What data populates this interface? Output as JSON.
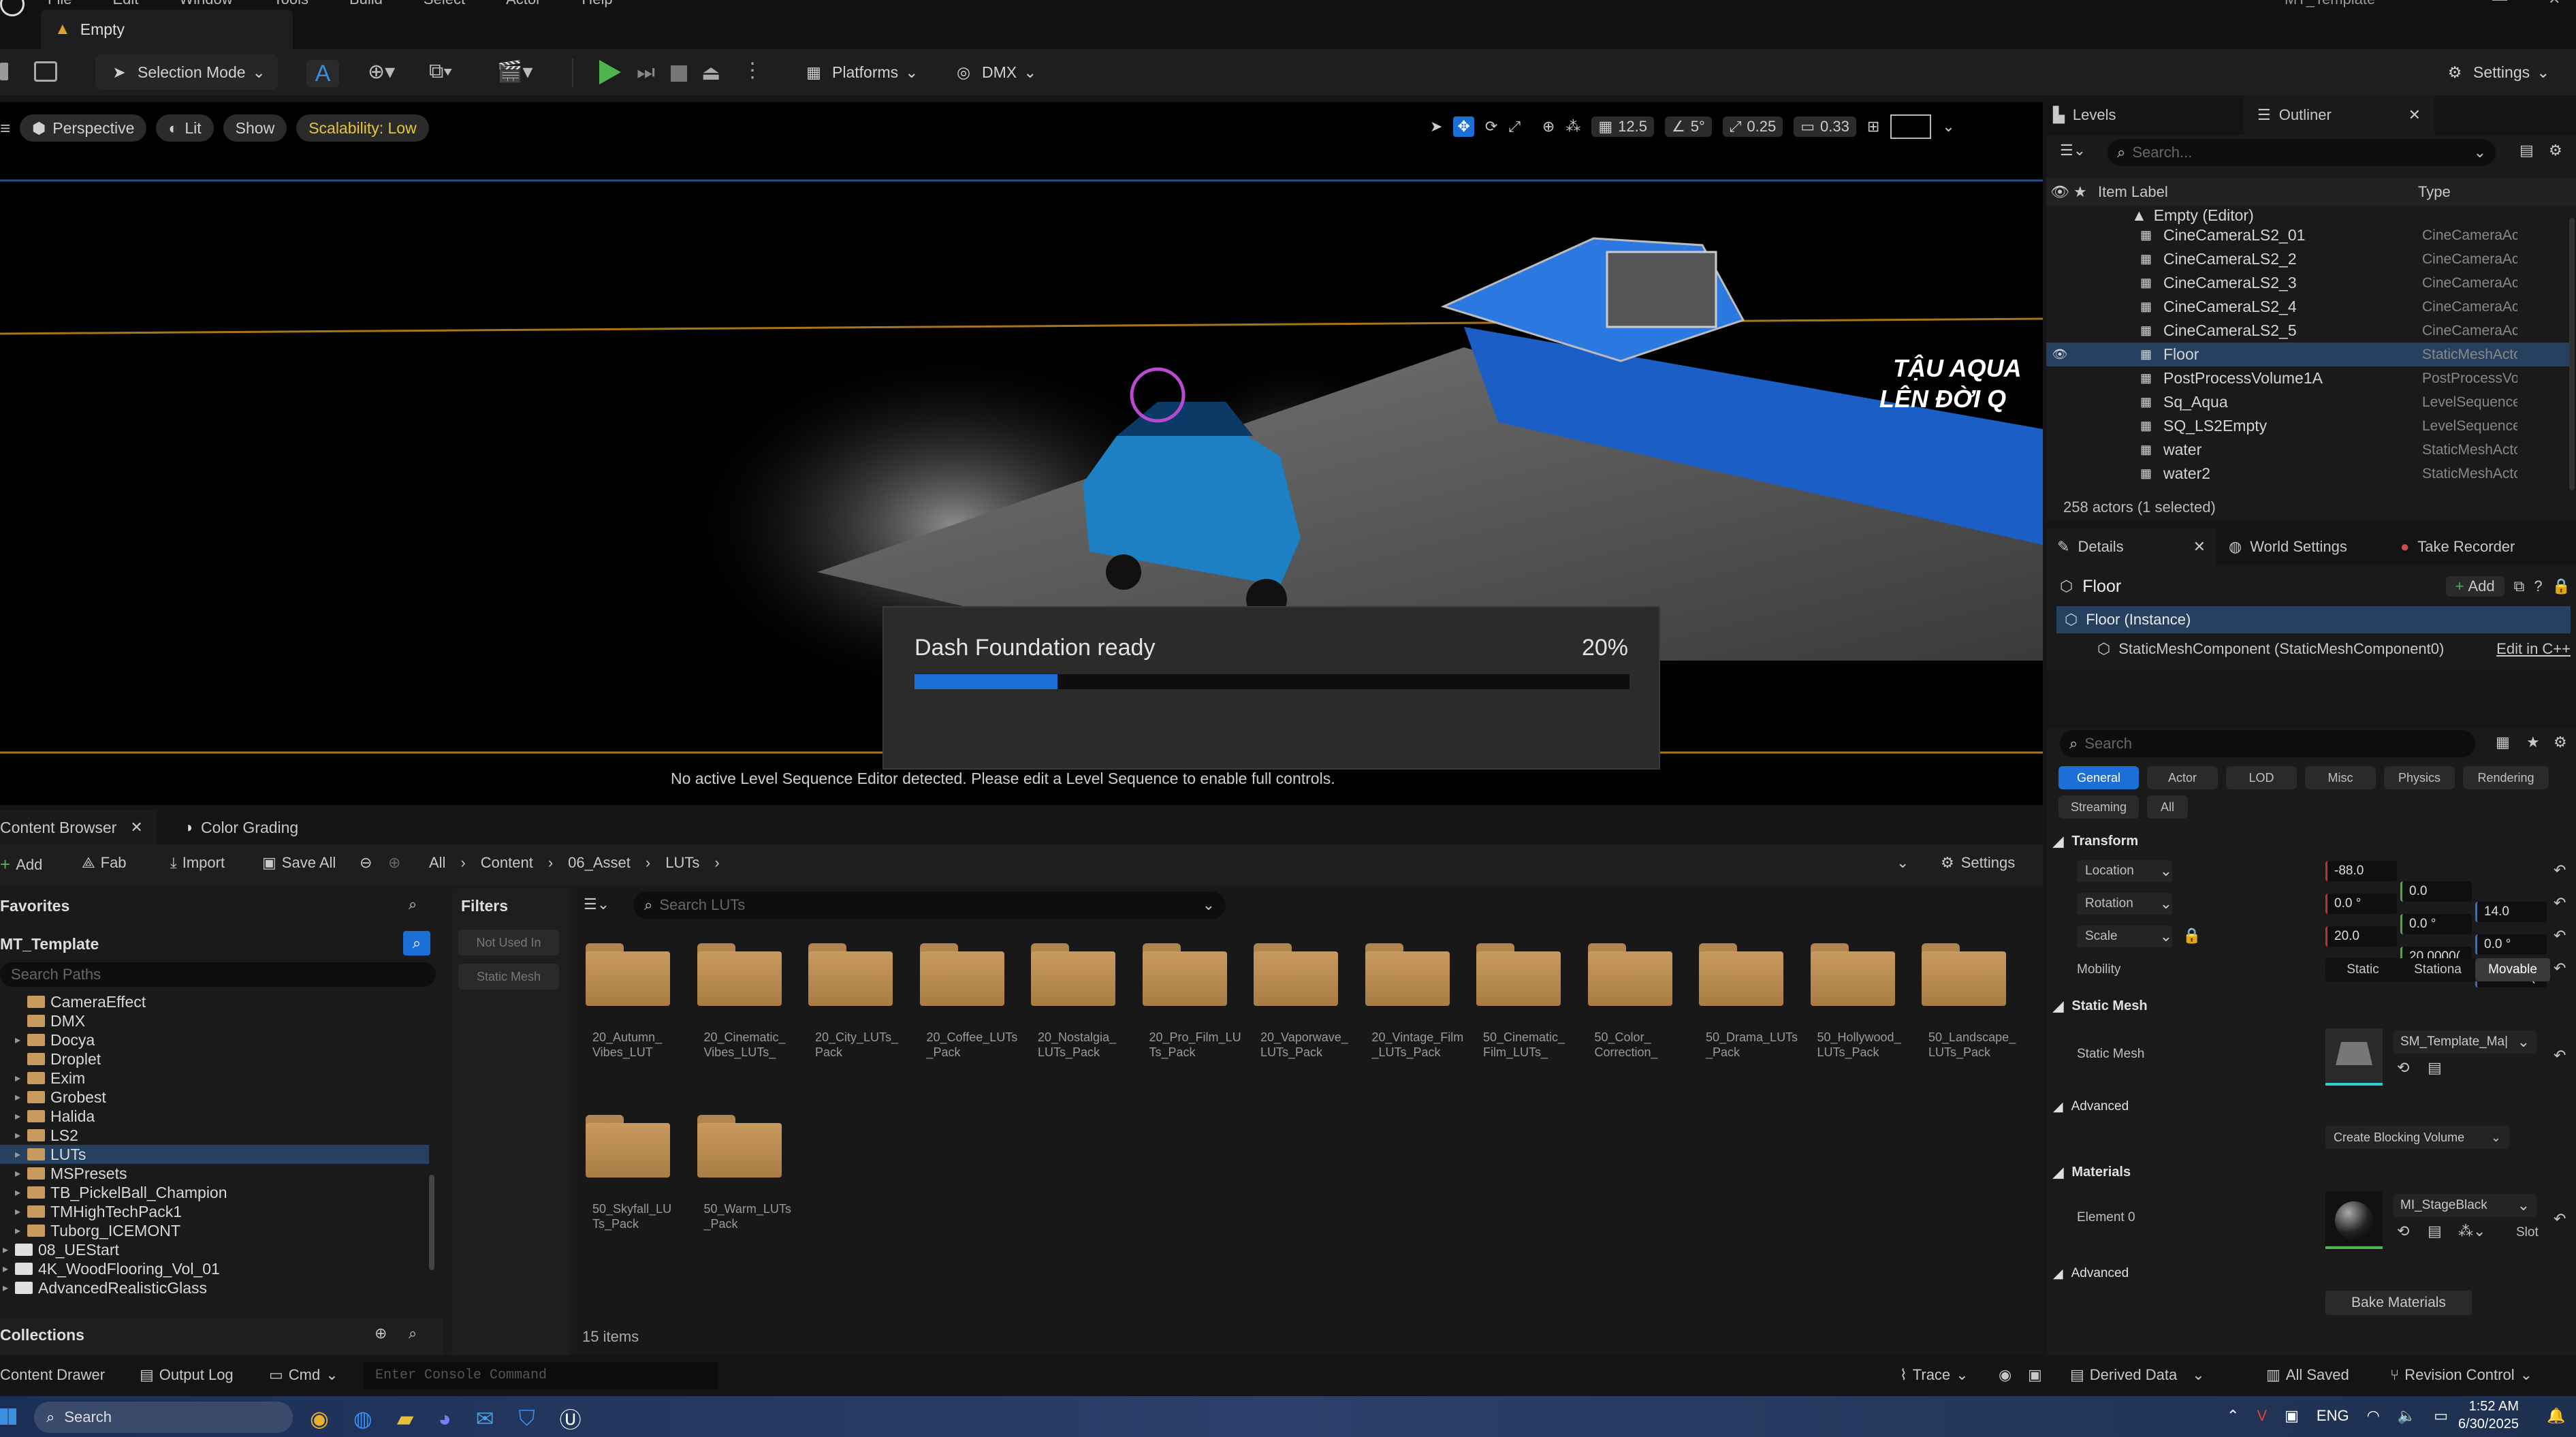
{
  "window": {
    "menu": [
      "File",
      "Edit",
      "Window",
      "Tools",
      "Build",
      "Select",
      "Actor",
      "Help"
    ],
    "level_tab": "Empty",
    "project_title": "MT_Template"
  },
  "toolbar": {
    "selection_mode": "Selection Mode",
    "platforms": "Platforms",
    "dmx": "DMX",
    "settings": "Settings"
  },
  "viewport": {
    "perspective": "Perspective",
    "lit": "Lit",
    "show": "Show",
    "scalability": "Scalability: Low",
    "grid_snap": "12.5",
    "rot_snap": "5°",
    "scale_snap": "0.25",
    "camera_speed": "0.33",
    "status": "No active Level Sequence Editor detected. Please edit a Level Sequence to enable full controls.",
    "banner_text_1": "TẬU AQUA",
    "banner_text_2": "LÊN ĐỜI Q"
  },
  "progress_dialog": {
    "title": "Dash Foundation ready",
    "percent_label": "20%",
    "progress": 0.2
  },
  "content_browser": {
    "tab": "Content Browser",
    "tab2": "Color Grading",
    "add": "Add",
    "fab": "Fab",
    "import": "Import",
    "save_all": "Save All",
    "breadcrumb": [
      "All",
      "Content",
      "06_Asset",
      "LUTs"
    ],
    "settings": "Settings",
    "favorites": "Favorites",
    "project": "MT_Template",
    "search_paths_placeholder": "Search Paths",
    "tree": [
      {
        "label": "CameraEffect",
        "depth": 1,
        "arrow": false
      },
      {
        "label": "DMX",
        "depth": 1,
        "arrow": false
      },
      {
        "label": "Docya",
        "depth": 1,
        "arrow": true
      },
      {
        "label": "Droplet",
        "depth": 1,
        "arrow": false
      },
      {
        "label": "Exim",
        "depth": 1,
        "arrow": true
      },
      {
        "label": "Grobest",
        "depth": 1,
        "arrow": true
      },
      {
        "label": "Halida",
        "depth": 1,
        "arrow": true
      },
      {
        "label": "LS2",
        "depth": 1,
        "arrow": true
      },
      {
        "label": "LUTs",
        "depth": 1,
        "arrow": true,
        "selected": true
      },
      {
        "label": "MSPresets",
        "depth": 1,
        "arrow": true
      },
      {
        "label": "TB_PickelBall_Champion",
        "depth": 1,
        "arrow": true
      },
      {
        "label": "TMHighTechPack1",
        "depth": 1,
        "arrow": true
      },
      {
        "label": "Tuborg_ICEMONT",
        "depth": 1,
        "arrow": true
      },
      {
        "label": "08_UEStart",
        "depth": 0,
        "arrow": true
      },
      {
        "label": "4K_WoodFlooring_Vol_01",
        "depth": 0,
        "arrow": true
      },
      {
        "label": "AdvancedRealisticGlass",
        "depth": 0,
        "arrow": true
      }
    ],
    "collections": "Collections",
    "filters": "Filters",
    "filter_chips": [
      "Not Used In",
      "Static Mesh"
    ],
    "search_placeholder": "Search LUTs",
    "assets": [
      [
        "20_Autumn_",
        "Vibes_LUT"
      ],
      [
        "20_Cinematic_",
        "Vibes_LUTs_"
      ],
      [
        "20_City_LUTs_",
        "Pack"
      ],
      [
        "20_Coffee_LUTs",
        "_Pack"
      ],
      [
        "20_Nostalgia_",
        "LUTs_Pack"
      ],
      [
        "20_Pro_Film_LU",
        "Ts_Pack"
      ],
      [
        "20_Vaporwave_",
        "LUTs_Pack"
      ],
      [
        "20_Vintage_Film",
        "_LUTs_Pack"
      ],
      [
        "50_Cinematic_",
        "Film_LUTs_"
      ],
      [
        "50_Color_",
        "Correction_"
      ],
      [
        "50_Drama_LUTs",
        "_Pack"
      ],
      [
        "50_Hollywood_",
        "LUTs_Pack"
      ],
      [
        "50_Landscape_",
        "LUTs_Pack"
      ],
      [
        "50_Skyfall_LU",
        "Ts_Pack"
      ],
      [
        "50_Warm_LUTs",
        "_Pack"
      ]
    ],
    "item_count": "15 items"
  },
  "outliner": {
    "tab_levels": "Levels",
    "tab_outliner": "Outliner",
    "search_placeholder": "Search...",
    "col_label": "Item Label",
    "col_type": "Type",
    "root": "Empty (Editor)",
    "rows": [
      {
        "label": "CineCameraLS2_01",
        "type": "CineCameraActo"
      },
      {
        "label": "CineCameraLS2_2",
        "type": "CineCameraActo"
      },
      {
        "label": "CineCameraLS2_3",
        "type": "CineCameraActo"
      },
      {
        "label": "CineCameraLS2_4",
        "type": "CineCameraActo"
      },
      {
        "label": "CineCameraLS2_5",
        "type": "CineCameraActo"
      },
      {
        "label": "Floor",
        "type": "StaticMeshActor",
        "selected": true
      },
      {
        "label": "PostProcessVolume1A",
        "type": "PostProcessVolu"
      },
      {
        "label": "Sq_Aqua",
        "type": "LevelSequenceAc"
      },
      {
        "label": "SQ_LS2Empty",
        "type": "LevelSequenceAc"
      },
      {
        "label": "water",
        "type": "StaticMeshActor"
      },
      {
        "label": "water2",
        "type": "StaticMeshActor"
      }
    ],
    "status": "258 actors (1 selected)"
  },
  "details": {
    "tab_details": "Details",
    "tab_world": "World Settings",
    "tab_recorder": "Take Recorder",
    "actor_name": "Floor",
    "add": "Add",
    "instance": "Floor (Instance)",
    "component": "StaticMeshComponent (StaticMeshComponent0)",
    "edit_cpp": "Edit in C++",
    "search_placeholder": "Search",
    "categories": [
      "General",
      "Actor",
      "LOD",
      "Misc",
      "Physics",
      "Rendering"
    ],
    "categories2": [
      "Streaming",
      "All"
    ],
    "transform": "Transform",
    "location_label": "Location",
    "location": [
      "-88.0",
      "0.0",
      "14.0"
    ],
    "rotation_label": "Rotation",
    "rotation": [
      "0.0 °",
      "0.0 °",
      "0.0 °"
    ],
    "scale_label": "Scale",
    "scale": [
      "20.0",
      "20.0000(",
      "20.0000("
    ],
    "mobility_label": "Mobility",
    "mobility": [
      "Static",
      "Stationa",
      "Movable"
    ],
    "static_mesh_section": "Static Mesh",
    "static_mesh_label": "Static Mesh",
    "static_mesh_value": "SM_Template_Ma|",
    "advanced": "Advanced",
    "create_blocking": "Create Blocking Volume",
    "materials": "Materials",
    "element0": "Element 0",
    "material_value": "MI_StageBlack",
    "slot": "Slot",
    "advanced2": "Advanced",
    "bake_materials": "Bake Materials"
  },
  "status_bar": {
    "content_drawer": "Content Drawer",
    "output_log": "Output Log",
    "cmd": "Cmd",
    "console_placeholder": "Enter Console Command",
    "trace": "Trace",
    "derived_data": "Derived Data",
    "all_saved": "All Saved",
    "revision_control": "Revision Control"
  },
  "taskbar": {
    "search": "Search",
    "lang": "ENG",
    "time": "1:52 AM",
    "date": "6/30/2025"
  },
  "colors": {
    "accent_blue": "#1d6fd8",
    "play_green": "#4fb34f",
    "scalability_yellow": "#e8c43a",
    "selection_row": "#264060"
  }
}
